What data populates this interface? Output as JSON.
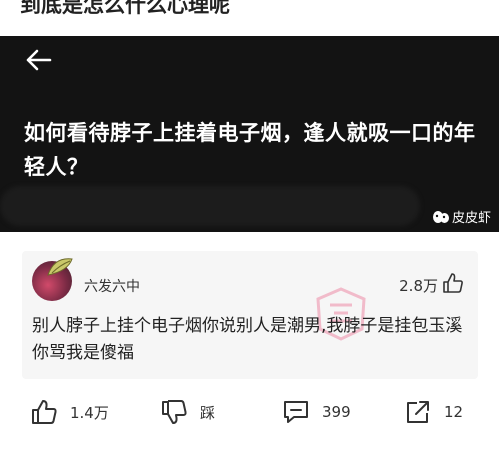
{
  "caption": "到底是怎么什么心理呢",
  "post": {
    "title": "如何看待脖子上挂着电子烟，逢人就吸一口的年轻人？",
    "brand": "皮皮虾"
  },
  "comment": {
    "username": "六发六中",
    "likes": "2.8万",
    "text": "别人脖子上挂个电子烟你说别人是潮男,我脖子是挂包玉溪你骂我是傻福"
  },
  "actions": {
    "like_count": "1.4万",
    "dislike_label": "踩",
    "comment_count": "399",
    "share_count": "12"
  },
  "icons": {
    "back": "back-arrow-icon",
    "brand": "shrimp-logo-icon",
    "like": "thumbs-up-icon",
    "dislike": "thumbs-down-icon",
    "comment": "comment-bubble-icon",
    "share": "share-icon"
  },
  "colors": {
    "header_bg": "#131313",
    "card_bg": "#f6f6f6",
    "stamp": "#e8507a"
  }
}
